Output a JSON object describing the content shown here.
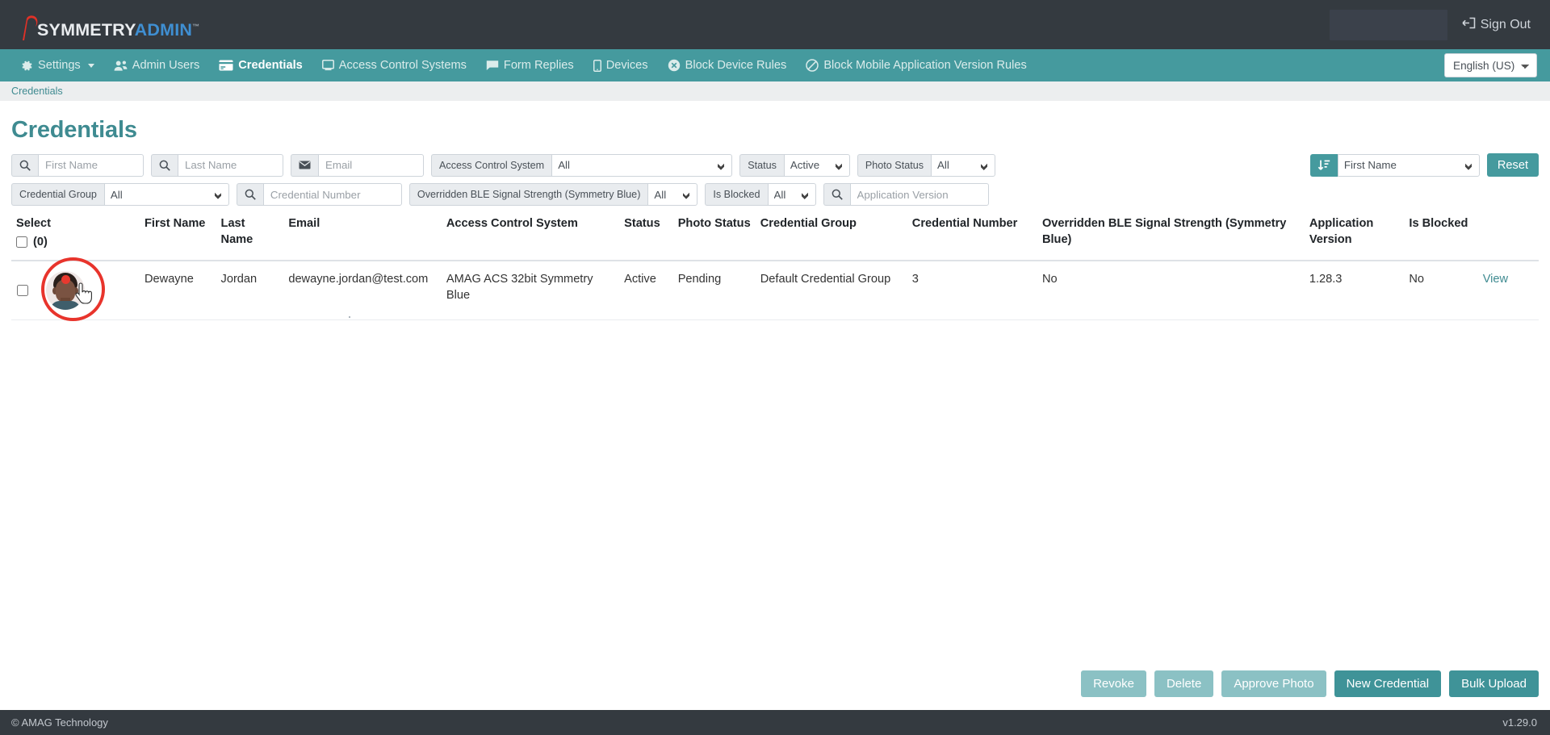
{
  "brand": {
    "part1": "SYMMETRY",
    "part2": "ADMIN",
    "tm": "™"
  },
  "header": {
    "sign_out": "Sign Out",
    "sign_out_icon": "sign-out-icon",
    "redacted_field": ""
  },
  "nav": {
    "items": [
      {
        "label": "Settings",
        "icon": "gear-icon",
        "active": false,
        "caret": true
      },
      {
        "label": "Admin Users",
        "icon": "users-icon",
        "active": false
      },
      {
        "label": "Credentials",
        "icon": "card-icon",
        "active": true
      },
      {
        "label": "Access Control Systems",
        "icon": "panel-icon",
        "active": false
      },
      {
        "label": "Form Replies",
        "icon": "chat-icon",
        "active": false
      },
      {
        "label": "Devices",
        "icon": "mobile-icon",
        "active": false
      },
      {
        "label": "Block Device Rules",
        "icon": "ban-x-icon",
        "active": false
      },
      {
        "label": "Block Mobile Application Version Rules",
        "icon": "ban-icon",
        "active": false
      }
    ],
    "language": "English (US)"
  },
  "breadcrumb": {
    "item": "Credentials"
  },
  "page": {
    "title": "Credentials"
  },
  "filters": {
    "row1": {
      "first_name_placeholder": "First Name",
      "first_name_value": "",
      "last_name_placeholder": "Last Name",
      "last_name_value": "",
      "email_placeholder": "Email",
      "email_value": "",
      "acs_label": "Access Control System",
      "acs_value": "All",
      "status_label": "Status",
      "status_value": "Active",
      "photo_status_label": "Photo Status",
      "photo_status_value": "All",
      "sort_value": "First Name",
      "reset_label": "Reset"
    },
    "row2": {
      "credential_group_label": "Credential Group",
      "credential_group_value": "All",
      "credential_number_placeholder": "Credential Number",
      "credential_number_value": "",
      "ble_label": "Overridden BLE Signal Strength (Symmetry Blue)",
      "ble_value": "All",
      "is_blocked_label": "Is Blocked",
      "is_blocked_value": "All",
      "app_version_placeholder": "Application Version",
      "app_version_value": ""
    }
  },
  "table": {
    "headers": {
      "select": "Select",
      "select_count": "(0)",
      "first_name": "First Name",
      "last_name": "Last Name",
      "email": "Email",
      "acs": "Access Control System",
      "status": "Status",
      "photo_status": "Photo Status",
      "credential_group": "Credential Group",
      "credential_number": "Credential Number",
      "ble": "Overridden BLE Signal Strength (Symmetry Blue)",
      "app_version": "Application Version",
      "is_blocked": "Is Blocked"
    },
    "rows": [
      {
        "avatar": "user-photo",
        "photo_badge": "pending-badge",
        "first_name": "Dewayne",
        "last_name": "Jordan",
        "email": "dewayne.jordan@test.com",
        "acs": "AMAG ACS 32bit Symmetry Blue",
        "status": "Active",
        "photo_status": "Pending",
        "credential_group": "Default Credential Group",
        "credential_number": "3",
        "ble": "No",
        "app_version": "1.28.3",
        "is_blocked": "No",
        "view": "View"
      }
    ]
  },
  "actions": {
    "revoke": "Revoke",
    "delete": "Delete",
    "approve_photo": "Approve Photo",
    "new_credential": "New Credential",
    "bulk_upload": "Bulk Upload"
  },
  "footer": {
    "copyright": "© AMAG Technology",
    "version": "v1.29.0"
  },
  "colors": {
    "teal": "#459a9e",
    "dark": "#343a40",
    "accent_light": "#8bc1c4",
    "highlight_red": "#e8342c"
  }
}
